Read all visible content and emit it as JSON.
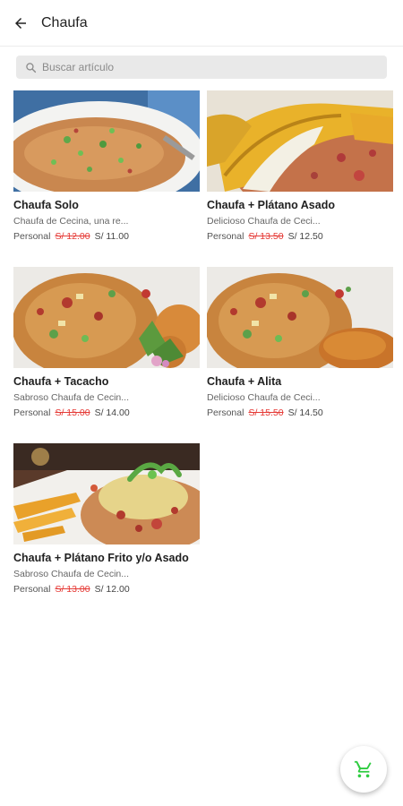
{
  "header": {
    "title": "Chaufa",
    "back_icon": "arrow-left-icon"
  },
  "search": {
    "placeholder": "Buscar artículo",
    "value": "",
    "icon": "search-icon"
  },
  "products": [
    {
      "name": "Chaufa Solo",
      "description": "Chaufa de Cecina, una re...",
      "size": "Personal",
      "old_price": "S/ 12.00",
      "price": "S/ 11.00"
    },
    {
      "name": "Chaufa + Plátano Asado",
      "description": "Delicioso Chaufa de Ceci...",
      "size": "Personal",
      "old_price": "S/ 13.50",
      "price": "S/ 12.50"
    },
    {
      "name": "Chaufa + Tacacho",
      "description": "Sabroso Chaufa de Cecin...",
      "size": "Personal",
      "old_price": "S/ 15.00",
      "price": "S/ 14.00"
    },
    {
      "name": "Chaufa + Alita",
      "description": "Delicioso Chaufa de Ceci...",
      "size": "Personal",
      "old_price": "S/ 15.50",
      "price": "S/ 14.50"
    },
    {
      "name": "Chaufa + Plátano Frito y/o Asado",
      "description": "Sabroso Chaufa de Cecin...",
      "size": "Personal",
      "old_price": "S/ 13.00",
      "price": "S/ 12.00"
    }
  ],
  "cart": {
    "icon": "cart-icon",
    "color": "#2ecc40"
  },
  "colors": {
    "strike_price": "#e53935",
    "search_bg": "#e9e9e9"
  }
}
